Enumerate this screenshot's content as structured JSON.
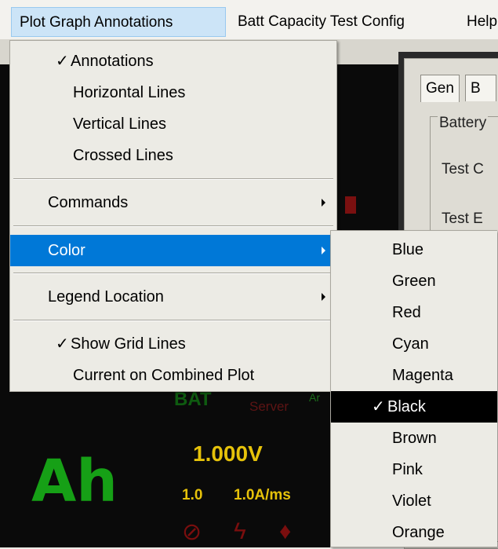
{
  "menubar": {
    "items": [
      {
        "label": "Plot Graph Annotations",
        "active": true
      },
      {
        "label": "Batt Capacity Test Config",
        "active": false
      },
      {
        "label": "Help",
        "active": false
      }
    ]
  },
  "main_menu": {
    "annotations": {
      "label": "Annotations",
      "checked": true
    },
    "horizontal_lines": {
      "label": "Horizontal Lines"
    },
    "vertical_lines": {
      "label": "Vertical Lines"
    },
    "crossed_lines": {
      "label": "Crossed Lines"
    },
    "commands": {
      "label": "Commands"
    },
    "color": {
      "label": "Color"
    },
    "legend_location": {
      "label": "Legend Location"
    },
    "show_grid_lines": {
      "label": "Show Grid Lines",
      "checked": true
    },
    "current_combined": {
      "label": "Current on Combined Plot"
    },
    "checkmark": "✓"
  },
  "color_menu": {
    "items": [
      "Blue",
      "Green",
      "Red",
      "Cyan",
      "Magenta",
      "Black",
      "Brown",
      "Pink",
      "Violet",
      "Orange"
    ],
    "selected": "Black",
    "checkmark": "✓"
  },
  "background": {
    "tabs": [
      "Gen",
      "B"
    ],
    "group_label": "Battery",
    "labels": [
      "Test C",
      "Test E"
    ],
    "bat": "BAT",
    "server": "Server",
    "ar": "Ar",
    "ah": "Ah",
    "voltage": "1.000V",
    "left_value": "1.0",
    "rate": "1.0A/ms"
  },
  "colors": {
    "highlight": "#0078d7",
    "selected_bg": "#000000",
    "menu_bg": "#ecebe5",
    "ah_green": "#16a016",
    "voltage_yellow": "#e6c20a"
  }
}
